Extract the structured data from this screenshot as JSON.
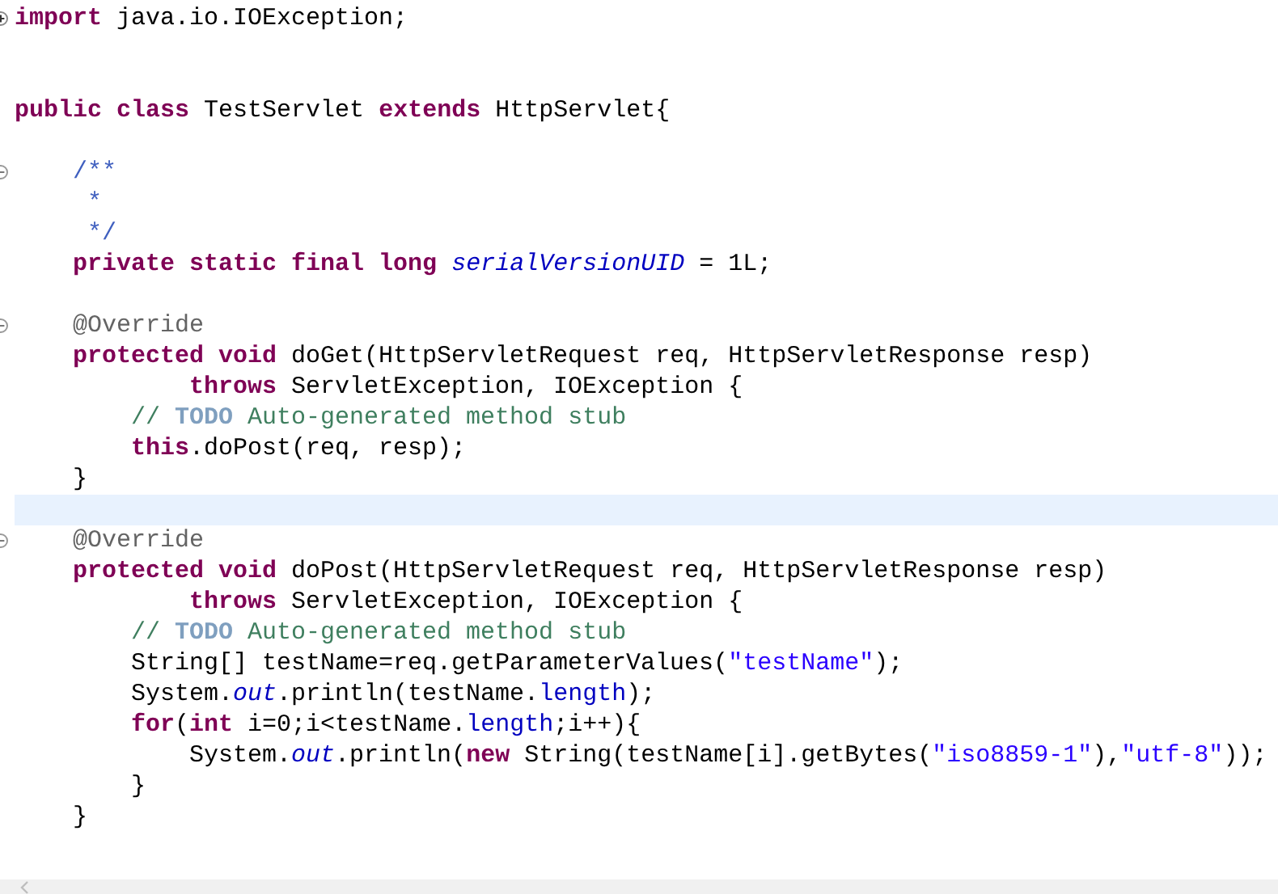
{
  "editor": {
    "lines": [
      {
        "kind": "code",
        "expanded": false,
        "tokens": [
          {
            "kind": "keyword",
            "text": "import"
          },
          {
            "kind": "plain",
            "text": " java.io.IOException;"
          }
        ]
      },
      {
        "kind": "blank"
      },
      {
        "kind": "blank"
      },
      {
        "kind": "code",
        "tokens": [
          {
            "kind": "keyword",
            "text": "public"
          },
          {
            "kind": "keyword",
            "text": " class"
          },
          {
            "kind": "plain",
            "text": " TestServlet "
          },
          {
            "kind": "keyword",
            "text": "extends"
          },
          {
            "kind": "plain",
            "text": " HttpServlet{"
          }
        ],
        "children": [
          {
            "kind": "blank"
          },
          {
            "kind": "code",
            "expanded": true,
            "tokens": [
              {
                "kind": "javadoc",
                "text": "/**"
              }
            ]
          },
          {
            "kind": "code",
            "tokens": [
              {
                "kind": "javadoc",
                "text": " *"
              }
            ]
          },
          {
            "kind": "code",
            "tokens": [
              {
                "kind": "javadoc",
                "text": " */"
              }
            ]
          },
          {
            "kind": "code",
            "tokens": [
              {
                "kind": "keyword",
                "text": "private"
              },
              {
                "kind": "keyword",
                "text": " static"
              },
              {
                "kind": "keyword",
                "text": " final"
              },
              {
                "kind": "keyword",
                "text": " long"
              },
              {
                "kind": "field",
                "text": " serialVersionUID"
              },
              {
                "kind": "plain",
                "text": " = 1L;"
              }
            ]
          },
          {
            "kind": "blank"
          },
          {
            "kind": "code",
            "expanded": true,
            "tokens": [
              {
                "kind": "annotation",
                "text": "@Override"
              }
            ]
          },
          {
            "kind": "code",
            "tokens": [
              {
                "kind": "keyword",
                "text": "protected"
              },
              {
                "kind": "keyword",
                "text": " void"
              },
              {
                "kind": "plain",
                "text": " doGet(HttpServletRequest req, HttpServletResponse resp)"
              }
            ],
            "children": [
              {
                "kind": "code",
                "continuation": true,
                "tokens": [
                  {
                    "kind": "keyword",
                    "text": "throws"
                  },
                  {
                    "kind": "plain",
                    "text": " ServletException, IOException {"
                  }
                ]
              },
              {
                "kind": "code",
                "tokens": [
                  {
                    "kind": "comment",
                    "text": "//"
                  },
                  {
                    "kind": "todo",
                    "text": " TODO"
                  },
                  {
                    "kind": "comment",
                    "text": " Auto-generated method stub"
                  }
                ]
              },
              {
                "kind": "code",
                "tokens": [
                  {
                    "kind": "keyword",
                    "text": "this"
                  },
                  {
                    "kind": "plain",
                    "text": ".doPost(req, resp);"
                  }
                ]
              }
            ]
          },
          {
            "kind": "code",
            "tokens": [
              {
                "kind": "plain",
                "text": "}"
              }
            ]
          },
          {
            "kind": "blank",
            "current": true
          },
          {
            "kind": "code",
            "expanded": true,
            "tokens": [
              {
                "kind": "annotation",
                "text": "@Override"
              }
            ]
          },
          {
            "kind": "code",
            "tokens": [
              {
                "kind": "keyword",
                "text": "protected"
              },
              {
                "kind": "keyword",
                "text": " void"
              },
              {
                "kind": "plain",
                "text": " doPost(HttpServletRequest req, HttpServletResponse resp)"
              }
            ],
            "children": [
              {
                "kind": "code",
                "continuation": true,
                "tokens": [
                  {
                    "kind": "keyword",
                    "text": "throws"
                  },
                  {
                    "kind": "plain",
                    "text": " ServletException, IOException {"
                  }
                ]
              },
              {
                "kind": "code",
                "tokens": [
                  {
                    "kind": "comment",
                    "text": "//"
                  },
                  {
                    "kind": "todo",
                    "text": " TODO"
                  },
                  {
                    "kind": "comment",
                    "text": " Auto-generated method stub"
                  }
                ]
              },
              {
                "kind": "code",
                "tokens": [
                  {
                    "kind": "plain",
                    "text": "String[] testName=req.getParameterValues("
                  },
                  {
                    "kind": "string",
                    "text": "\"testName\""
                  },
                  {
                    "kind": "plain",
                    "text": ");"
                  }
                ]
              },
              {
                "kind": "code",
                "tokens": [
                  {
                    "kind": "plain",
                    "text": "System."
                  },
                  {
                    "kind": "field",
                    "text": "out"
                  },
                  {
                    "kind": "plain",
                    "text": ".println(testName."
                  },
                  {
                    "kind": "member",
                    "text": "length"
                  },
                  {
                    "kind": "plain",
                    "text": ");"
                  }
                ]
              },
              {
                "kind": "code",
                "tokens": [
                  {
                    "kind": "keyword",
                    "text": "for"
                  },
                  {
                    "kind": "plain",
                    "text": "("
                  },
                  {
                    "kind": "keyword",
                    "text": "int"
                  },
                  {
                    "kind": "plain",
                    "text": " i=0;i<testName."
                  },
                  {
                    "kind": "member",
                    "text": "length"
                  },
                  {
                    "kind": "plain",
                    "text": ";i++){"
                  }
                ],
                "children": [
                  {
                    "kind": "code",
                    "tokens": [
                      {
                        "kind": "plain",
                        "text": "System."
                      },
                      {
                        "kind": "field",
                        "text": "out"
                      },
                      {
                        "kind": "plain",
                        "text": ".println("
                      },
                      {
                        "kind": "keyword",
                        "text": "new"
                      },
                      {
                        "kind": "plain",
                        "text": " String(testName[i].getBytes("
                      },
                      {
                        "kind": "string",
                        "text": "\"iso8859-1\""
                      },
                      {
                        "kind": "plain",
                        "text": "),"
                      },
                      {
                        "kind": "string",
                        "text": "\"utf-8\""
                      },
                      {
                        "kind": "plain",
                        "text": "));"
                      }
                    ]
                  }
                ]
              },
              {
                "kind": "code",
                "tokens": [
                  {
                    "kind": "plain",
                    "text": "}"
                  }
                ]
              }
            ]
          },
          {
            "kind": "code",
            "tokens": [
              {
                "kind": "plain",
                "text": "}"
              }
            ]
          }
        ]
      },
      {
        "kind": "blank"
      }
    ]
  }
}
